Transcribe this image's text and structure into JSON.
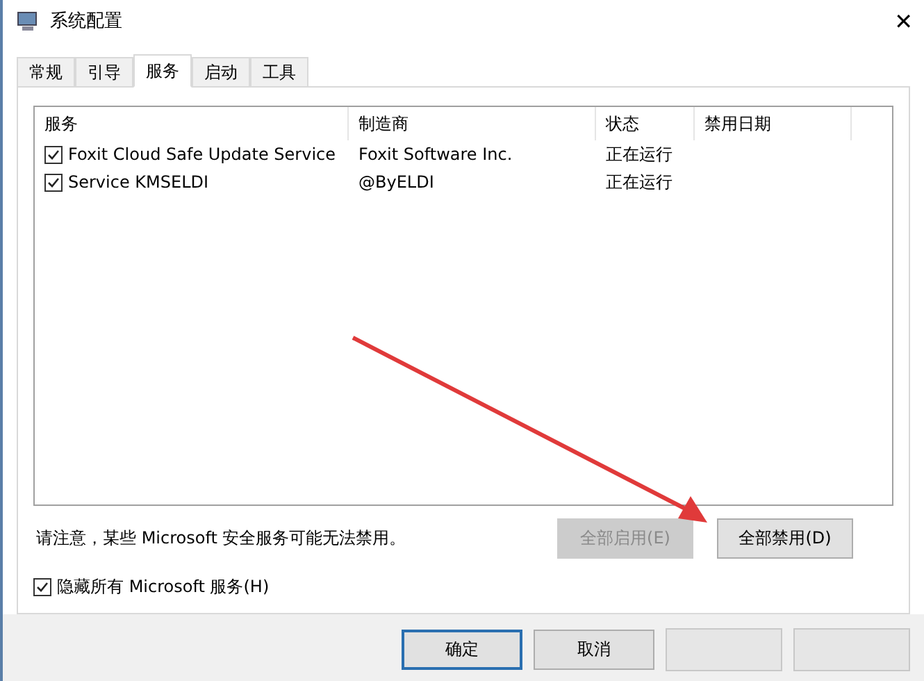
{
  "window": {
    "title": "系统配置",
    "close": "✕"
  },
  "tabs": [
    {
      "label": "常规",
      "selected": false
    },
    {
      "label": "引导",
      "selected": false
    },
    {
      "label": "服务",
      "selected": true
    },
    {
      "label": "启动",
      "selected": false
    },
    {
      "label": "工具",
      "selected": false
    }
  ],
  "table": {
    "columns": [
      "服务",
      "制造商",
      "状态",
      "禁用日期"
    ],
    "rows": [
      {
        "checked": true,
        "cells": [
          "Foxit Cloud Safe Update Service",
          "Foxit Software Inc.",
          "正在运行",
          ""
        ]
      },
      {
        "checked": true,
        "cells": [
          "Service KMSELDI",
          "@ByELDI",
          "正在运行",
          ""
        ]
      }
    ]
  },
  "note": "请注意，某些 Microsoft 安全服务可能无法禁用。",
  "actions": [
    {
      "label": "全部启用(E)",
      "disabled": true
    },
    {
      "label": "全部禁用(D)",
      "disabled": false
    }
  ],
  "hide_microsoft": {
    "label": "隐藏所有 Microsoft 服务(H)",
    "checked": true
  },
  "footer_buttons": [
    {
      "label": "确定",
      "focused": true
    },
    {
      "label": "取消",
      "focused": false
    }
  ]
}
